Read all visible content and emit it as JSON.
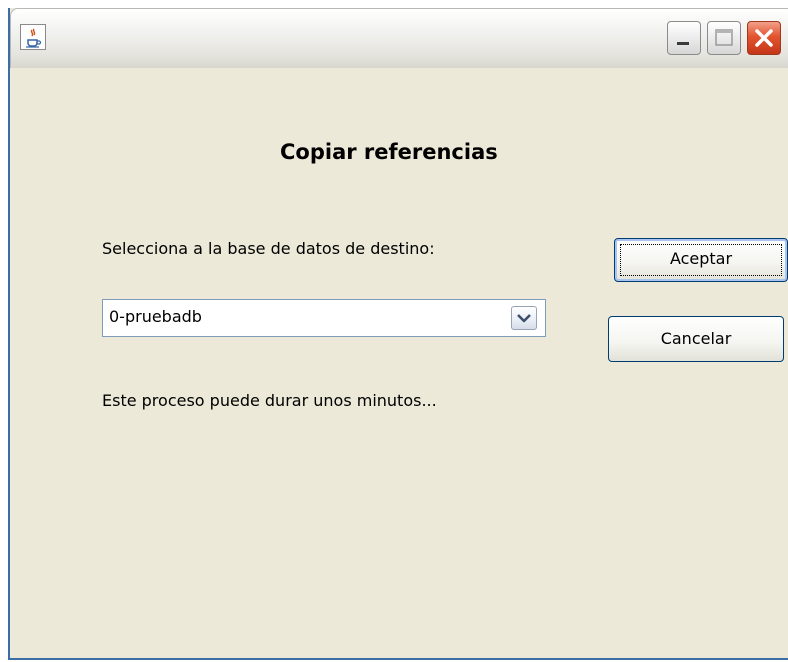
{
  "window": {
    "title": "",
    "icon": "java-cup-icon",
    "controls": [
      "minimize-icon",
      "maximize-icon",
      "close-icon"
    ]
  },
  "dialog": {
    "heading": "Copiar referencias",
    "select_label": "Selecciona a la base de datos de destino:",
    "database_select": {
      "selected_value": "0-pruebadb"
    },
    "info_text": "Este proceso puede durar unos minutos...",
    "accept_label": "Aceptar",
    "cancel_label": "Cancelar"
  },
  "colors": {
    "window_bg": "#ece9d8",
    "close_button": "#e2542e",
    "field_border": "#7f9db9",
    "button_border": "#003c74"
  }
}
